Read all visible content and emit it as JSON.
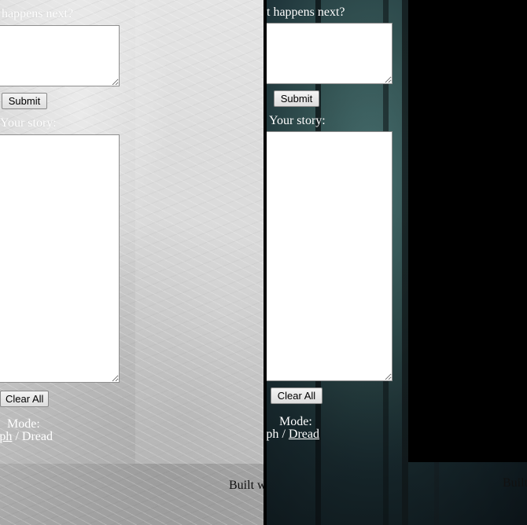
{
  "left_panel": {
    "prompt_label": "happens next?",
    "submit_label": "Submit",
    "story_label": "Your story:",
    "clear_label": "Clear All",
    "mode_label": "Mode:",
    "mode_options": {
      "first": "raph",
      "separator": " / ",
      "second": "Dread"
    },
    "footer_text": "Built w"
  },
  "right_panel": {
    "prompt_label": "t happens next?",
    "submit_label": "Submit",
    "story_label": "Your story:",
    "clear_label": "Clear All",
    "mode_label": "Mode:",
    "mode_options": {
      "first": "raph",
      "separator": " / ",
      "second": "Dread"
    },
    "footer_text": "Built"
  },
  "colors": {
    "light_panel_base": "#c9c9c9",
    "dark_panel_base": "#1e3339",
    "text_light": "#ffffff",
    "text_dark": "#111111"
  },
  "icons": [
    "textarea-resize-handle",
    "forest-background",
    "feather-background"
  ]
}
